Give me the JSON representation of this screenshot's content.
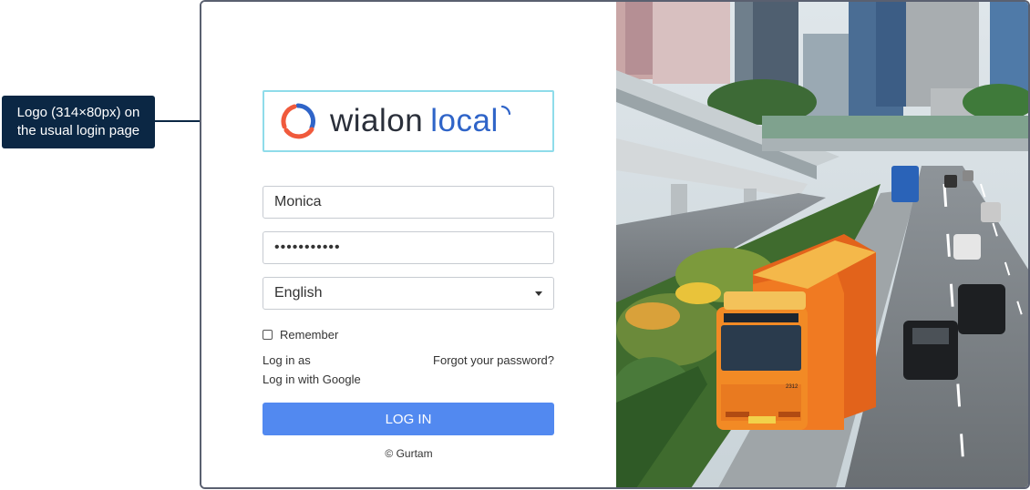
{
  "annotation": {
    "text": "Logo (314×80px) on the usual login page"
  },
  "logo": {
    "word1": "wialon",
    "word2": "local",
    "brand_color": "#2f64c8",
    "mark_color": "#f05a3c"
  },
  "form": {
    "username": "Monica",
    "password_mask": "•••••••••••",
    "language": "English",
    "remember_label": "Remember",
    "login_as_label": "Log in as",
    "login_google_label": "Log in with Google",
    "forgot_label": "Forgot your password?",
    "login_button": "LOG IN",
    "button_color": "#5289f0"
  },
  "footer": {
    "copyright": "© Gurtam"
  },
  "photo": {
    "description_icon": "city-bus-photo",
    "bus_number": "2312"
  }
}
